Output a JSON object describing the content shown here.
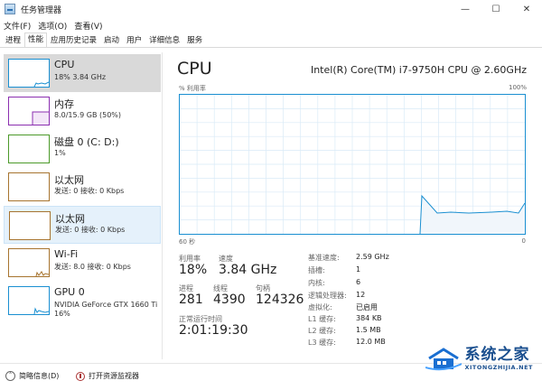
{
  "window": {
    "title": "任务管理器",
    "controls": {
      "minimize": "—",
      "maximize": "☐",
      "close": "✕"
    }
  },
  "menu": [
    "文件(F)",
    "选项(O)",
    "查看(V)"
  ],
  "tabs": [
    {
      "label": "进程",
      "active": false
    },
    {
      "label": "性能",
      "active": true
    },
    {
      "label": "应用历史记录",
      "active": false
    },
    {
      "label": "启动",
      "active": false
    },
    {
      "label": "用户",
      "active": false
    },
    {
      "label": "详细信息",
      "active": false
    },
    {
      "label": "服务",
      "active": false
    }
  ],
  "sidebar": {
    "items": [
      {
        "title": "CPU",
        "sub": "18% 3.84 GHz",
        "sub2": "",
        "color": "#1a8fd1"
      },
      {
        "title": "内存",
        "sub": "8.0/15.9 GB (50%)",
        "sub2": "",
        "color": "#8b2fb0"
      },
      {
        "title": "磁盘 0 (C: D:)",
        "sub": "1%",
        "sub2": "",
        "color": "#4c9a2a"
      },
      {
        "title": "以太网",
        "sub": "发送: 0 接收: 0 Kbps",
        "sub2": "",
        "color": "#a7742f"
      },
      {
        "title": "以太网",
        "sub": "发送: 0 接收: 0 Kbps",
        "sub2": "",
        "color": "#a7742f"
      },
      {
        "title": "Wi-Fi",
        "sub": "发送: 8.0 接收: 0 Kbps",
        "sub2": "",
        "color": "#a7742f"
      },
      {
        "title": "GPU 0",
        "sub": "NVIDIA GeForce GTX 1660 Ti",
        "sub2": "16%",
        "color": "#1a8fd1"
      }
    ]
  },
  "main": {
    "title": "CPU",
    "model": "Intel(R) Core(TM) i7-9750H CPU @ 2.60GHz",
    "graph": {
      "label_left": "% 利用率",
      "label_right": "100%",
      "time_left": "60 秒",
      "time_right": "0",
      "line_color": "#1a8fd1",
      "fill_color": "#f1f6fb"
    },
    "stats": {
      "utilization_label": "利用率",
      "utilization": "18%",
      "speed_label": "速度",
      "speed": "3.84 GHz",
      "processes_label": "进程",
      "processes": "281",
      "threads_label": "线程",
      "threads": "4390",
      "handles_label": "句柄",
      "handles": "124326",
      "uptime_label": "正常运行时间",
      "uptime": "2:01:19:30"
    },
    "specs": [
      {
        "key": "基准速度:",
        "value": "2.59 GHz"
      },
      {
        "key": "插槽:",
        "value": "1"
      },
      {
        "key": "内核:",
        "value": "6"
      },
      {
        "key": "逻辑处理器:",
        "value": "12"
      },
      {
        "key": "虚拟化:",
        "value": "已启用"
      },
      {
        "key": "L1 缓存:",
        "value": "384 KB"
      },
      {
        "key": "L2 缓存:",
        "value": "1.5 MB"
      },
      {
        "key": "L3 缓存:",
        "value": "12.0 MB"
      }
    ]
  },
  "statusbar": {
    "summary": "简略信息(D)",
    "monitor": "打开资源监视器"
  },
  "watermark": {
    "title": "系统之家",
    "sub": "XITONGZHIJIA.NET"
  }
}
